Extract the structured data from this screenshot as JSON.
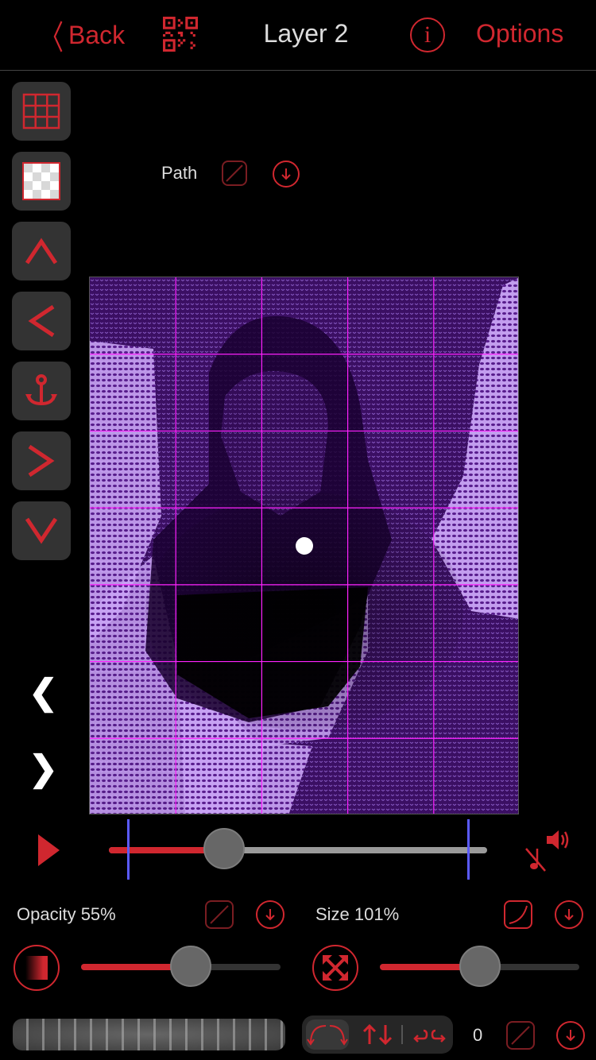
{
  "header": {
    "back_label": "Back",
    "title": "Layer 2",
    "options_label": "Options",
    "info_glyph": "i"
  },
  "sidebar": {
    "buttons": [
      {
        "name": "grid-toggle",
        "icon": "grid-icon"
      },
      {
        "name": "transparency-toggle",
        "icon": "checkerboard-icon"
      },
      {
        "name": "move-up",
        "icon": "arrow-up-icon"
      },
      {
        "name": "move-left",
        "icon": "arrow-left-icon"
      },
      {
        "name": "anchor",
        "icon": "anchor-icon"
      },
      {
        "name": "move-right",
        "icon": "arrow-right-icon"
      },
      {
        "name": "move-down",
        "icon": "arrow-down-icon"
      }
    ],
    "prev_glyph": "❮",
    "next_glyph": "❯"
  },
  "path": {
    "label": "Path"
  },
  "canvas": {
    "grid_columns": 5,
    "grid_rows": 7,
    "grid_color": "#ff22ff",
    "tint_dark": "#1a0030",
    "tint_light": "#c9a4f5"
  },
  "timeline": {
    "position": 0.305,
    "range_start": 0.05,
    "range_end": 0.95
  },
  "opacity": {
    "label": "Opacity 55%",
    "value": 0.55
  },
  "size": {
    "label": "Size 101%",
    "value": 0.5
  },
  "bottom": {
    "rotation_value": "0"
  },
  "colors": {
    "accent": "#d0272f",
    "marker": "#5a5aff",
    "button_bg": "#333333"
  }
}
